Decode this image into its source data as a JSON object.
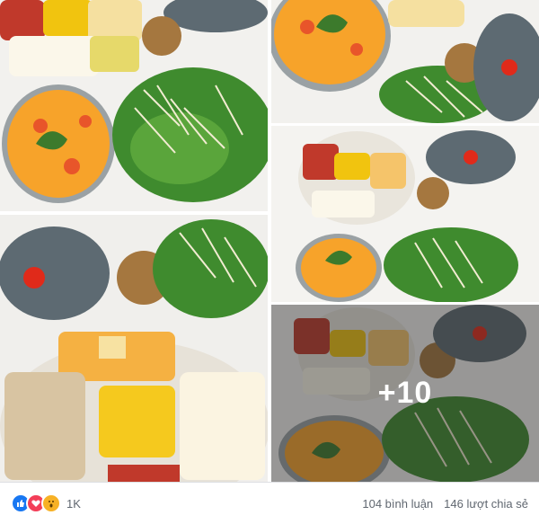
{
  "photos": [
    {
      "name": "photo-1"
    },
    {
      "name": "photo-2"
    },
    {
      "name": "photo-3"
    },
    {
      "name": "photo-4"
    },
    {
      "name": "photo-5"
    }
  ],
  "more_overlay": {
    "count_label": "+10"
  },
  "footer": {
    "reactions": [
      {
        "type": "like",
        "icon": "thumbs-up-icon",
        "color": "#1877f2"
      },
      {
        "type": "love",
        "icon": "heart-icon",
        "color": "#f33e58"
      },
      {
        "type": "wow",
        "icon": "wow-face-icon",
        "color": "#f7b125"
      }
    ],
    "reaction_count": "1K",
    "comments_label": "104 bình luận",
    "shares_label": "146 lượt chia sẻ"
  }
}
